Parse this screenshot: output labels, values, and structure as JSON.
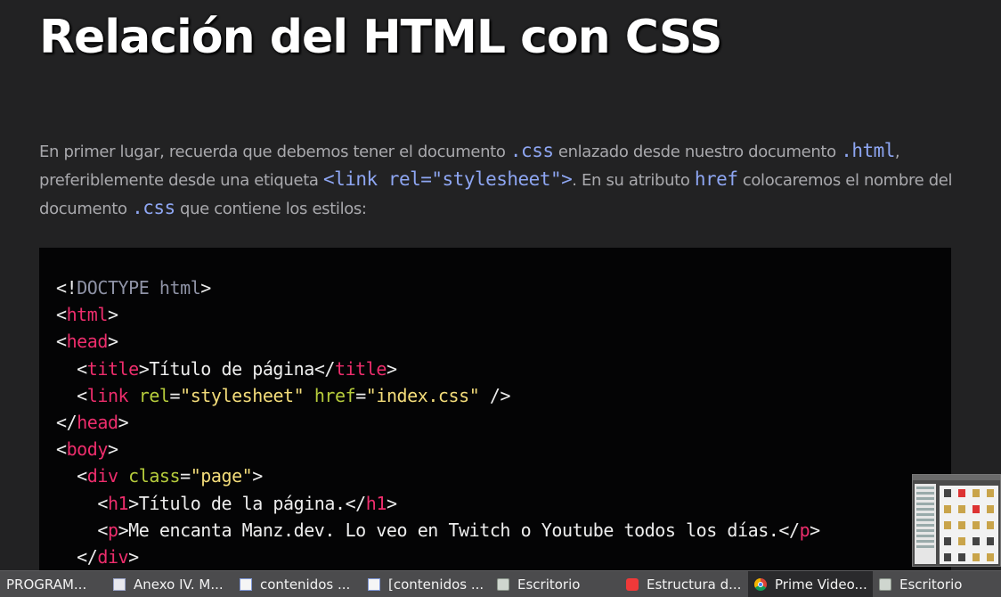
{
  "article": {
    "title": "Relación del HTML con CSS",
    "intro": [
      {
        "t": "text",
        "v": "En primer lugar, recuerda que debemos tener el documento "
      },
      {
        "t": "code",
        "v": ".css"
      },
      {
        "t": "text",
        "v": " enlazado desde nuestro documento "
      },
      {
        "t": "code",
        "v": ".html"
      },
      {
        "t": "text",
        "v": ", preferiblemente desde una etiqueta "
      },
      {
        "t": "code",
        "v": "<link rel=\"stylesheet\">"
      },
      {
        "t": "text",
        "v": ". En su atributo "
      },
      {
        "t": "code",
        "v": "href"
      },
      {
        "t": "text",
        "v": " colocaremos el nombre del documento "
      },
      {
        "t": "code",
        "v": ".css"
      },
      {
        "t": "text",
        "v": " que contiene los estilos:"
      }
    ]
  },
  "code_block": {
    "lines": [
      [
        [
          "punc",
          "<!"
        ],
        [
          "doct",
          "DOCTYPE html"
        ],
        [
          "punc",
          ">"
        ]
      ],
      [
        [
          "punc",
          "<"
        ],
        [
          "tag",
          "html"
        ],
        [
          "punc",
          ">"
        ]
      ],
      [
        [
          "punc",
          "<"
        ],
        [
          "tag",
          "head"
        ],
        [
          "punc",
          ">"
        ]
      ],
      [
        [
          "punc",
          "  <"
        ],
        [
          "tag",
          "title"
        ],
        [
          "punc",
          ">"
        ],
        [
          "txt",
          "Título de página"
        ],
        [
          "punc",
          "</"
        ],
        [
          "tag",
          "title"
        ],
        [
          "punc",
          ">"
        ]
      ],
      [
        [
          "punc",
          "  <"
        ],
        [
          "tag",
          "link"
        ],
        [
          "txt",
          " "
        ],
        [
          "attr",
          "rel"
        ],
        [
          "punc",
          "="
        ],
        [
          "str",
          "\"stylesheet\""
        ],
        [
          "txt",
          " "
        ],
        [
          "attr",
          "href"
        ],
        [
          "punc",
          "="
        ],
        [
          "str",
          "\"index.css\""
        ],
        [
          "punc",
          " />"
        ]
      ],
      [
        [
          "punc",
          "</"
        ],
        [
          "tag",
          "head"
        ],
        [
          "punc",
          ">"
        ]
      ],
      [
        [
          "punc",
          "<"
        ],
        [
          "tag",
          "body"
        ],
        [
          "punc",
          ">"
        ]
      ],
      [
        [
          "punc",
          "  <"
        ],
        [
          "tag",
          "div"
        ],
        [
          "txt",
          " "
        ],
        [
          "attr",
          "class"
        ],
        [
          "punc",
          "="
        ],
        [
          "str",
          "\"page\""
        ],
        [
          "punc",
          ">"
        ]
      ],
      [
        [
          "punc",
          "    <"
        ],
        [
          "tag",
          "h1"
        ],
        [
          "punc",
          ">"
        ],
        [
          "txt",
          "Título de la página."
        ],
        [
          "punc",
          "</"
        ],
        [
          "tag",
          "h1"
        ],
        [
          "punc",
          ">"
        ]
      ],
      [
        [
          "punc",
          "    <"
        ],
        [
          "tag",
          "p"
        ],
        [
          "punc",
          ">"
        ],
        [
          "txt",
          "Me encanta Manz.dev. Lo veo en Twitch o Youtube todos los días."
        ],
        [
          "punc",
          "</"
        ],
        [
          "tag",
          "p"
        ],
        [
          "punc",
          ">"
        ]
      ],
      [
        [
          "punc",
          "  </"
        ],
        [
          "tag",
          "div"
        ],
        [
          "punc",
          ">"
        ]
      ]
    ]
  },
  "taskbar": {
    "items": [
      {
        "label": "PROGRAM...",
        "icon": "none",
        "width": 120,
        "active": false
      },
      {
        "label": "Anexo IV. M...",
        "icon": "doc",
        "width": 142,
        "active": false
      },
      {
        "label": "contenidos ...",
        "icon": "doc2",
        "width": 144,
        "active": false
      },
      {
        "label": "[contenidos ...",
        "icon": "doc2",
        "width": 145,
        "active": false
      },
      {
        "label": "Escritorio",
        "icon": "folder",
        "width": 145,
        "active": false
      },
      {
        "label": "Estructura d...",
        "icon": "viv",
        "width": 144,
        "active": false
      },
      {
        "label": "Prime Video...",
        "icon": "chrome",
        "width": 140,
        "active": true
      },
      {
        "label": "Escritorio",
        "icon": "folder",
        "width": 144,
        "active": false
      }
    ]
  }
}
